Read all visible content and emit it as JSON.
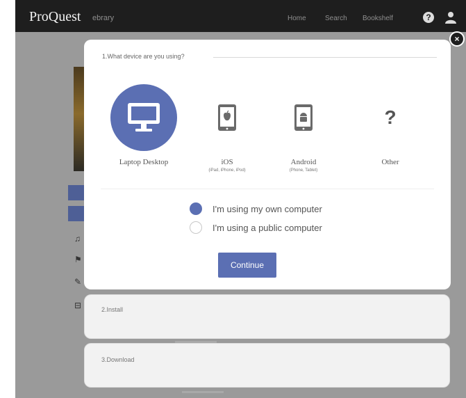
{
  "header": {
    "brand": "ProQuest",
    "brand_sub": "ebrary",
    "nav": {
      "home": "Home",
      "search": "Search",
      "bookshelf": "Bookshelf"
    },
    "help_icon": "?"
  },
  "modal": {
    "close_label": "×",
    "step1": {
      "label": "1.What device are you using?",
      "devices": [
        {
          "name": "Laptop Desktop",
          "sub": "",
          "icon": "monitor-icon",
          "selected": true
        },
        {
          "name": "iOS",
          "sub": "(iPad, iPhone, iPod)",
          "icon": "ios-device-icon",
          "selected": false
        },
        {
          "name": "Android",
          "sub": "(Phone, Tablet)",
          "icon": "android-device-icon",
          "selected": false
        },
        {
          "name": "Other",
          "sub": "",
          "icon": "question-mark-icon",
          "glyph": "?",
          "selected": false
        }
      ],
      "computer_options": [
        {
          "label": "I'm using my own computer",
          "checked": true
        },
        {
          "label": "I'm using a public computer",
          "checked": false
        }
      ],
      "continue_label": "Continue"
    },
    "step2": {
      "label": "2.Install"
    },
    "step3": {
      "label": "3.Download"
    }
  },
  "colors": {
    "accent": "#5b6fb3",
    "topbar": "#1e1e1e",
    "backdrop": "#9a9a9a"
  }
}
